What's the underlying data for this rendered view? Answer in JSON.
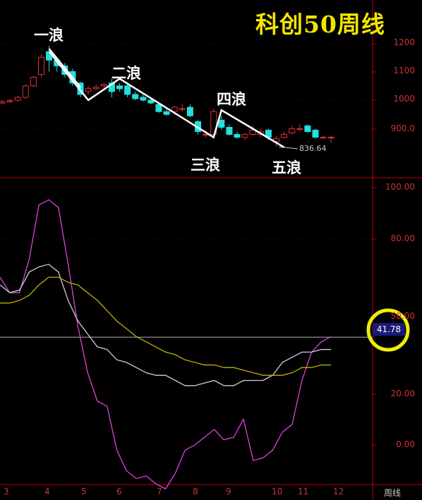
{
  "title": "科创50周线",
  "wave_labels": [
    "一浪",
    "二浪",
    "三浪",
    "四浪",
    "五浪"
  ],
  "low_marker": "836.64",
  "period_label": "周线",
  "current_indicator_value": "41.78",
  "colors": {
    "background": "#000000",
    "axis": "#c00000",
    "title": "#f2e600",
    "up": "#e03030",
    "down": "#20e0e0",
    "fast_line": "#e040e0",
    "mid_line": "#d0d0d0",
    "slow_line": "#c0b000",
    "circle": "#f0f000",
    "wave": "#ffffff"
  },
  "chart_data": [
    {
      "type": "candlestick",
      "title": "科创50周线",
      "ylim": [
        840,
        1250
      ],
      "y_ticks": [
        "1200",
        "1100",
        "1000",
        "900.0"
      ],
      "low_annotation": 836.64,
      "candles": [
        {
          "o": 990,
          "c": 995,
          "h": 1000,
          "l": 985
        },
        {
          "o": 995,
          "c": 998,
          "h": 1005,
          "l": 990
        },
        {
          "o": 1000,
          "c": 1010,
          "h": 1015,
          "l": 995
        },
        {
          "o": 1010,
          "c": 1050,
          "h": 1055,
          "l": 1005
        },
        {
          "o": 1050,
          "c": 1080,
          "h": 1085,
          "l": 1045
        },
        {
          "o": 1090,
          "c": 1150,
          "h": 1160,
          "l": 1080
        },
        {
          "o": 1170,
          "c": 1140,
          "h": 1190,
          "l": 1100
        },
        {
          "o": 1140,
          "c": 1120,
          "h": 1150,
          "l": 1100
        },
        {
          "o": 1120,
          "c": 1090,
          "h": 1130,
          "l": 1080
        },
        {
          "o": 1100,
          "c": 1060,
          "h": 1110,
          "l": 1050
        },
        {
          "o": 1060,
          "c": 1020,
          "h": 1065,
          "l": 1010
        },
        {
          "o": 1030,
          "c": 1040,
          "h": 1050,
          "l": 1020
        },
        {
          "o": 1040,
          "c": 1045,
          "h": 1055,
          "l": 1035
        },
        {
          "o": 1050,
          "c": 1055,
          "h": 1060,
          "l": 1040
        },
        {
          "o": 1060,
          "c": 1030,
          "h": 1075,
          "l": 1010
        },
        {
          "o": 1050,
          "c": 1040,
          "h": 1060,
          "l": 1030
        },
        {
          "o": 1050,
          "c": 1020,
          "h": 1060,
          "l": 1010
        },
        {
          "o": 1020,
          "c": 1005,
          "h": 1030,
          "l": 1000
        },
        {
          "o": 1010,
          "c": 1000,
          "h": 1020,
          "l": 995
        },
        {
          "o": 1000,
          "c": 990,
          "h": 1010,
          "l": 985
        },
        {
          "o": 985,
          "c": 960,
          "h": 990,
          "l": 955
        },
        {
          "o": 960,
          "c": 950,
          "h": 970,
          "l": 945
        },
        {
          "o": 960,
          "c": 975,
          "h": 980,
          "l": 950
        },
        {
          "o": 970,
          "c": 970,
          "h": 985,
          "l": 960
        },
        {
          "o": 975,
          "c": 945,
          "h": 985,
          "l": 940
        },
        {
          "o": 925,
          "c": 890,
          "h": 930,
          "l": 880
        },
        {
          "o": 880,
          "c": 880,
          "h": 895,
          "l": 870
        },
        {
          "o": 880,
          "c": 960,
          "h": 970,
          "l": 875
        },
        {
          "o": 930,
          "c": 905,
          "h": 945,
          "l": 895
        },
        {
          "o": 905,
          "c": 880,
          "h": 915,
          "l": 875
        },
        {
          "o": 880,
          "c": 870,
          "h": 890,
          "l": 865
        },
        {
          "o": 870,
          "c": 880,
          "h": 885,
          "l": 860
        },
        {
          "o": 880,
          "c": 895,
          "h": 910,
          "l": 875
        },
        {
          "o": 880,
          "c": 890,
          "h": 900,
          "l": 870
        },
        {
          "o": 895,
          "c": 870,
          "h": 900,
          "l": 860
        },
        {
          "o": 855,
          "c": 865,
          "h": 875,
          "l": 837
        },
        {
          "o": 870,
          "c": 880,
          "h": 890,
          "l": 865
        },
        {
          "o": 885,
          "c": 900,
          "h": 910,
          "l": 880
        },
        {
          "o": 900,
          "c": 900,
          "h": 915,
          "l": 890
        },
        {
          "o": 910,
          "c": 890,
          "h": 915,
          "l": 885
        },
        {
          "o": 895,
          "c": 870,
          "h": 900,
          "l": 865
        },
        {
          "o": 870,
          "c": 870,
          "h": 875,
          "l": 865
        },
        {
          "o": 870,
          "c": 870,
          "h": 875,
          "l": 850
        }
      ]
    },
    {
      "type": "line",
      "ylim": [
        -20,
        100
      ],
      "y_ticks": [
        "100.00",
        "80.00",
        "50.00",
        "20.00",
        "0.00"
      ],
      "x_ticks": [
        "3",
        "4",
        "5",
        "6",
        "7",
        "8",
        "9",
        "10",
        "11",
        "12"
      ],
      "reference_level": 41.78,
      "series": [
        {
          "values": [
            65,
            59,
            59,
            72,
            93,
            95,
            92,
            70,
            46,
            28,
            17,
            15,
            -2,
            -10,
            -13,
            -12,
            -15,
            -17,
            -11,
            -2,
            0,
            3,
            6,
            2,
            3,
            10,
            -6,
            -5,
            -2,
            5,
            8,
            25,
            36,
            40,
            42
          ]
        },
        {
          "values": [
            62,
            59,
            60,
            67,
            69,
            70,
            67,
            56,
            48,
            43,
            38,
            37,
            33,
            32,
            30,
            28,
            27,
            27,
            25,
            23,
            23,
            24,
            25,
            23,
            23,
            25,
            25,
            25,
            27,
            32,
            34,
            36,
            36,
            37,
            37
          ]
        },
        {
          "values": [
            55,
            55,
            56,
            58,
            62,
            65,
            65,
            63,
            62,
            59,
            56,
            52,
            48,
            45,
            42,
            40,
            38,
            36,
            35,
            33,
            32,
            31,
            31,
            30,
            30,
            29,
            28,
            27,
            27,
            27,
            28,
            30,
            30,
            31,
            31
          ]
        }
      ]
    }
  ]
}
